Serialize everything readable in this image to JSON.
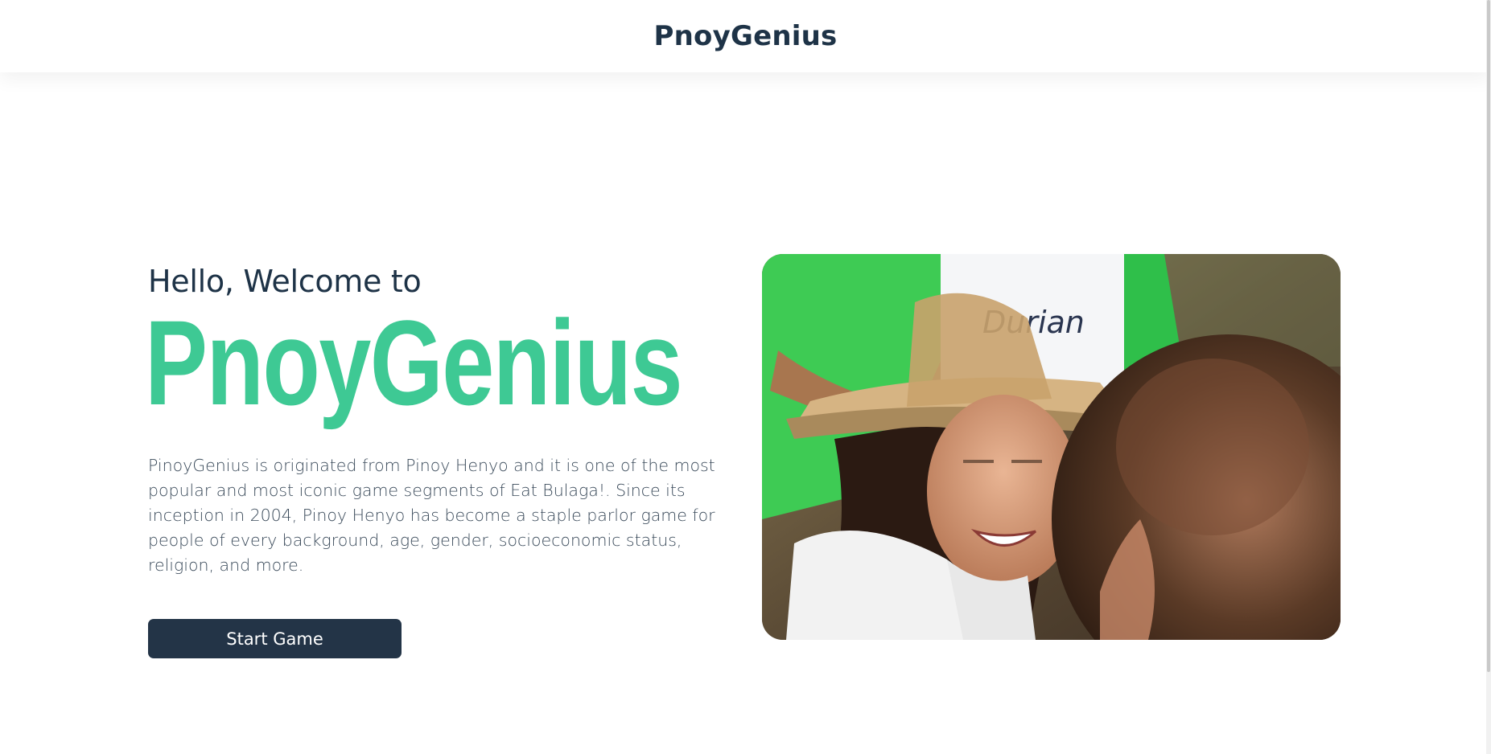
{
  "navbar": {
    "brand": "PnoyGenius"
  },
  "hero": {
    "greeting": "Hello, Welcome to",
    "title": "PnoyGenius",
    "description": "PinoyGenius is originated from Pinoy Henyo and it is one of the most popular and most iconic game segments of Eat Bulaga!. Since its inception in 2004, Pinoy Henyo has become a staple parlor game for people of every background, age, gender, socioeconomic status, religion, and more.",
    "start_button_label": "Start Game",
    "photo_card_text": "Durian"
  },
  "colors": {
    "primary_dark": "#1e3347",
    "accent_green": "#3ec994",
    "button_bg": "#233447"
  }
}
